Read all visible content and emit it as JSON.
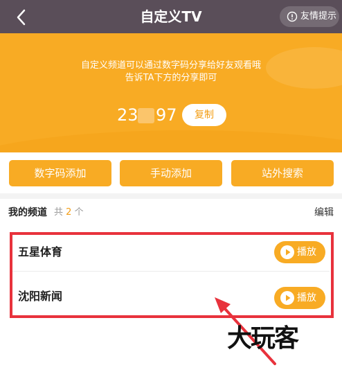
{
  "header": {
    "title": "自定义TV",
    "tip_label": "友情提示"
  },
  "hero": {
    "message_line1": "自定义频道可以通过数字码分享给好友观看哦",
    "message_line2": "告诉TA下方的分享即可",
    "code_visible_start": "23",
    "code_visible_end": "97",
    "copy_label": "复制"
  },
  "actions": [
    {
      "label": "数字码添加"
    },
    {
      "label": "手动添加"
    },
    {
      "label": "站外搜索"
    }
  ],
  "my_channels": {
    "title": "我的频道",
    "count_prefix": "共",
    "count_value": "2",
    "count_suffix": "个",
    "edit_label": "编辑"
  },
  "channels": [
    {
      "name": "五星体育",
      "play_label": "播放"
    },
    {
      "name": "沈阳新闻",
      "play_label": "播放"
    }
  ],
  "watermark": "大玩客",
  "colors": {
    "accent": "#f8ab24",
    "topbar": "#5a4e59",
    "highlight": "#e8323c"
  }
}
